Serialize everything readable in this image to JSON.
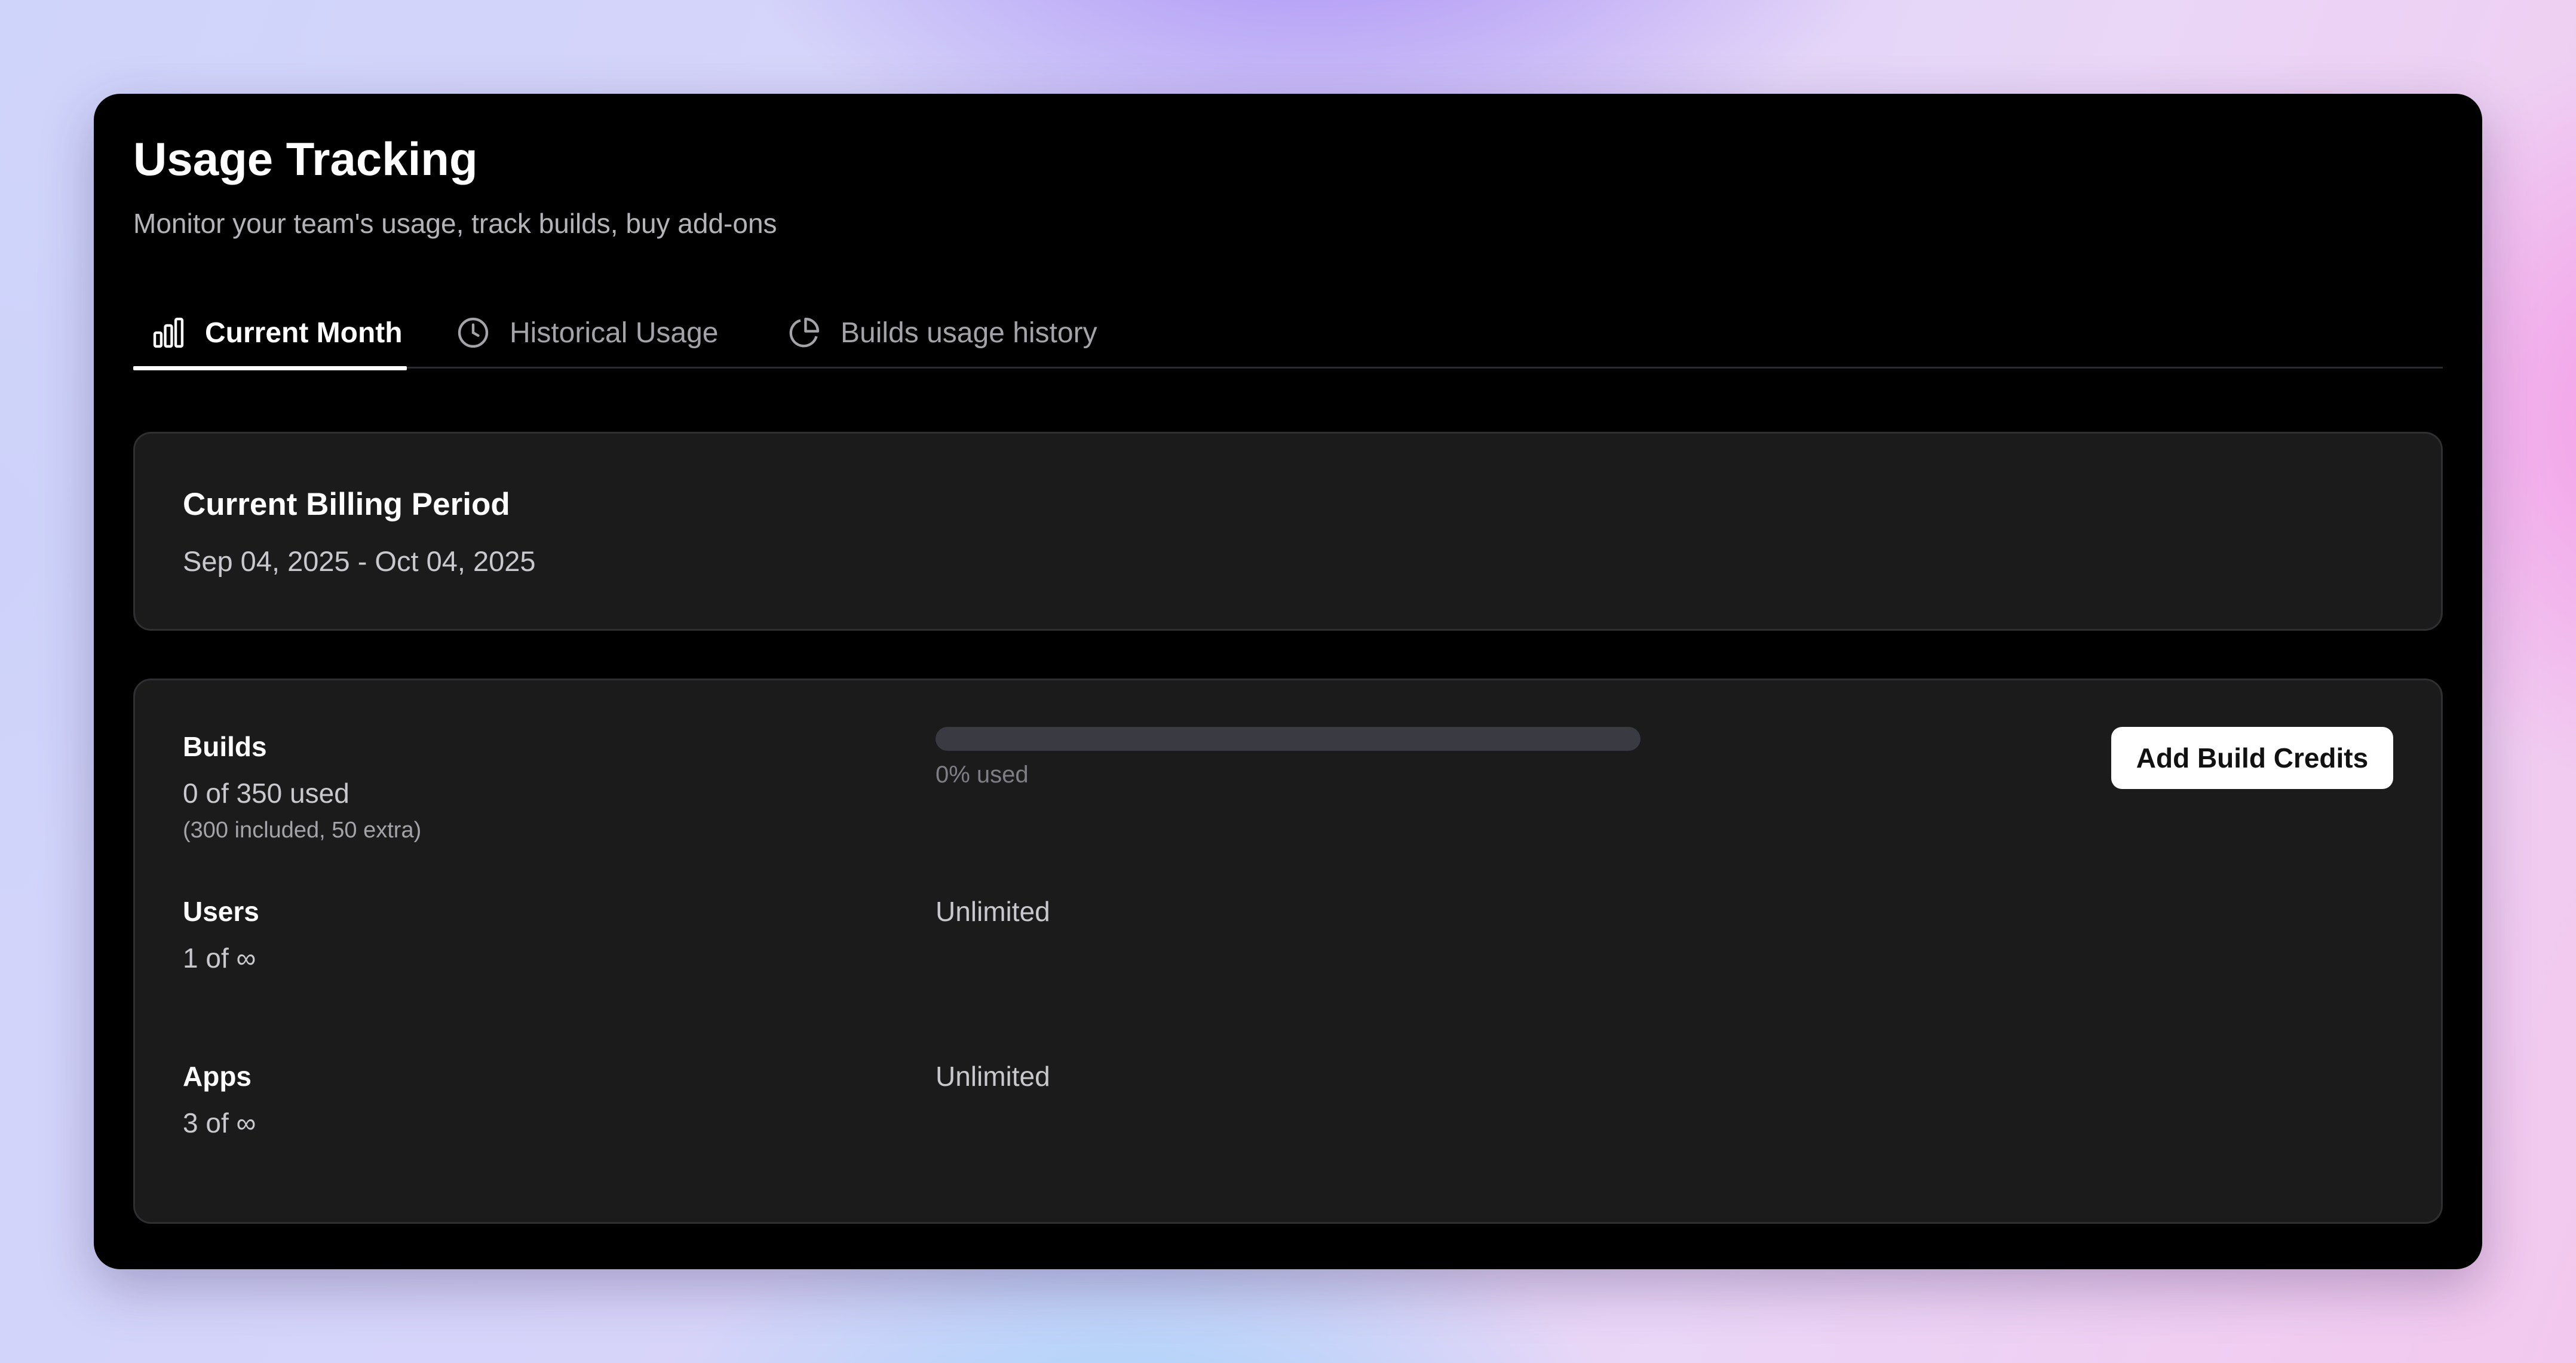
{
  "page": {
    "title": "Usage Tracking",
    "subtitle": "Monitor your team's usage, track builds, buy add-ons"
  },
  "tabs": [
    {
      "label": "Current Month",
      "icon": "bar-chart-icon",
      "active": true
    },
    {
      "label": "Historical Usage",
      "icon": "clock-icon",
      "active": false
    },
    {
      "label": "Builds usage history",
      "icon": "pie-chart-icon",
      "active": false
    }
  ],
  "billing": {
    "title": "Current Billing Period",
    "period": "Sep 04, 2025 - Oct 04, 2025"
  },
  "usage": {
    "builds": {
      "label": "Builds",
      "value": "0 of 350 used",
      "note": "(300 included, 50 extra)",
      "progress_percent": 0,
      "progress_text": "0% used",
      "action_label": "Add Build Credits"
    },
    "users": {
      "label": "Users",
      "value": "1 of ∞",
      "limit": "Unlimited"
    },
    "apps": {
      "label": "Apps",
      "value": "3 of ∞",
      "limit": "Unlimited"
    }
  },
  "colors": {
    "window_bg": "#000000",
    "card_bg": "#1b1b1c",
    "card_border": "#2f2f32",
    "progress_track": "#3a3b42",
    "button_bg": "#ffffff"
  }
}
